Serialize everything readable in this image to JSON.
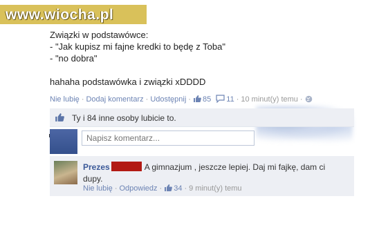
{
  "watermark": "www.wiocha.pl",
  "post": {
    "lines": [
      "Związki w podstawówce:",
      "- \"Jak kupisz mi fajne kredki to będę z Toba\"",
      "- \"no dobra\"",
      "hahaha podstawówka i związki xDDDD"
    ],
    "actions": {
      "unlike": "Nie lubię",
      "comment": "Dodaj komentarz",
      "share": "Udostępnij",
      "likes": "85",
      "comments": "11",
      "time": "10 minut(y) temu"
    }
  },
  "likes_summary": "Ty i 84 inne osoby lubicie to.",
  "comment_input": {
    "placeholder": "Napisz komentarz..."
  },
  "reply": {
    "author": "Prezes",
    "text": "A gimnazjum , jeszcze lepiej. Daj mi fajkę, dam ci dupy.",
    "actions": {
      "unlike": "Nie lubię",
      "reply": "Odpowiedz",
      "likes": "34",
      "time": "9 minut(y) temu"
    }
  },
  "colors": {
    "link": "#6d84b4",
    "likes_bg": "#edeff4",
    "watermark_bg": "#d9c15a",
    "redaction": "#b21a14"
  }
}
